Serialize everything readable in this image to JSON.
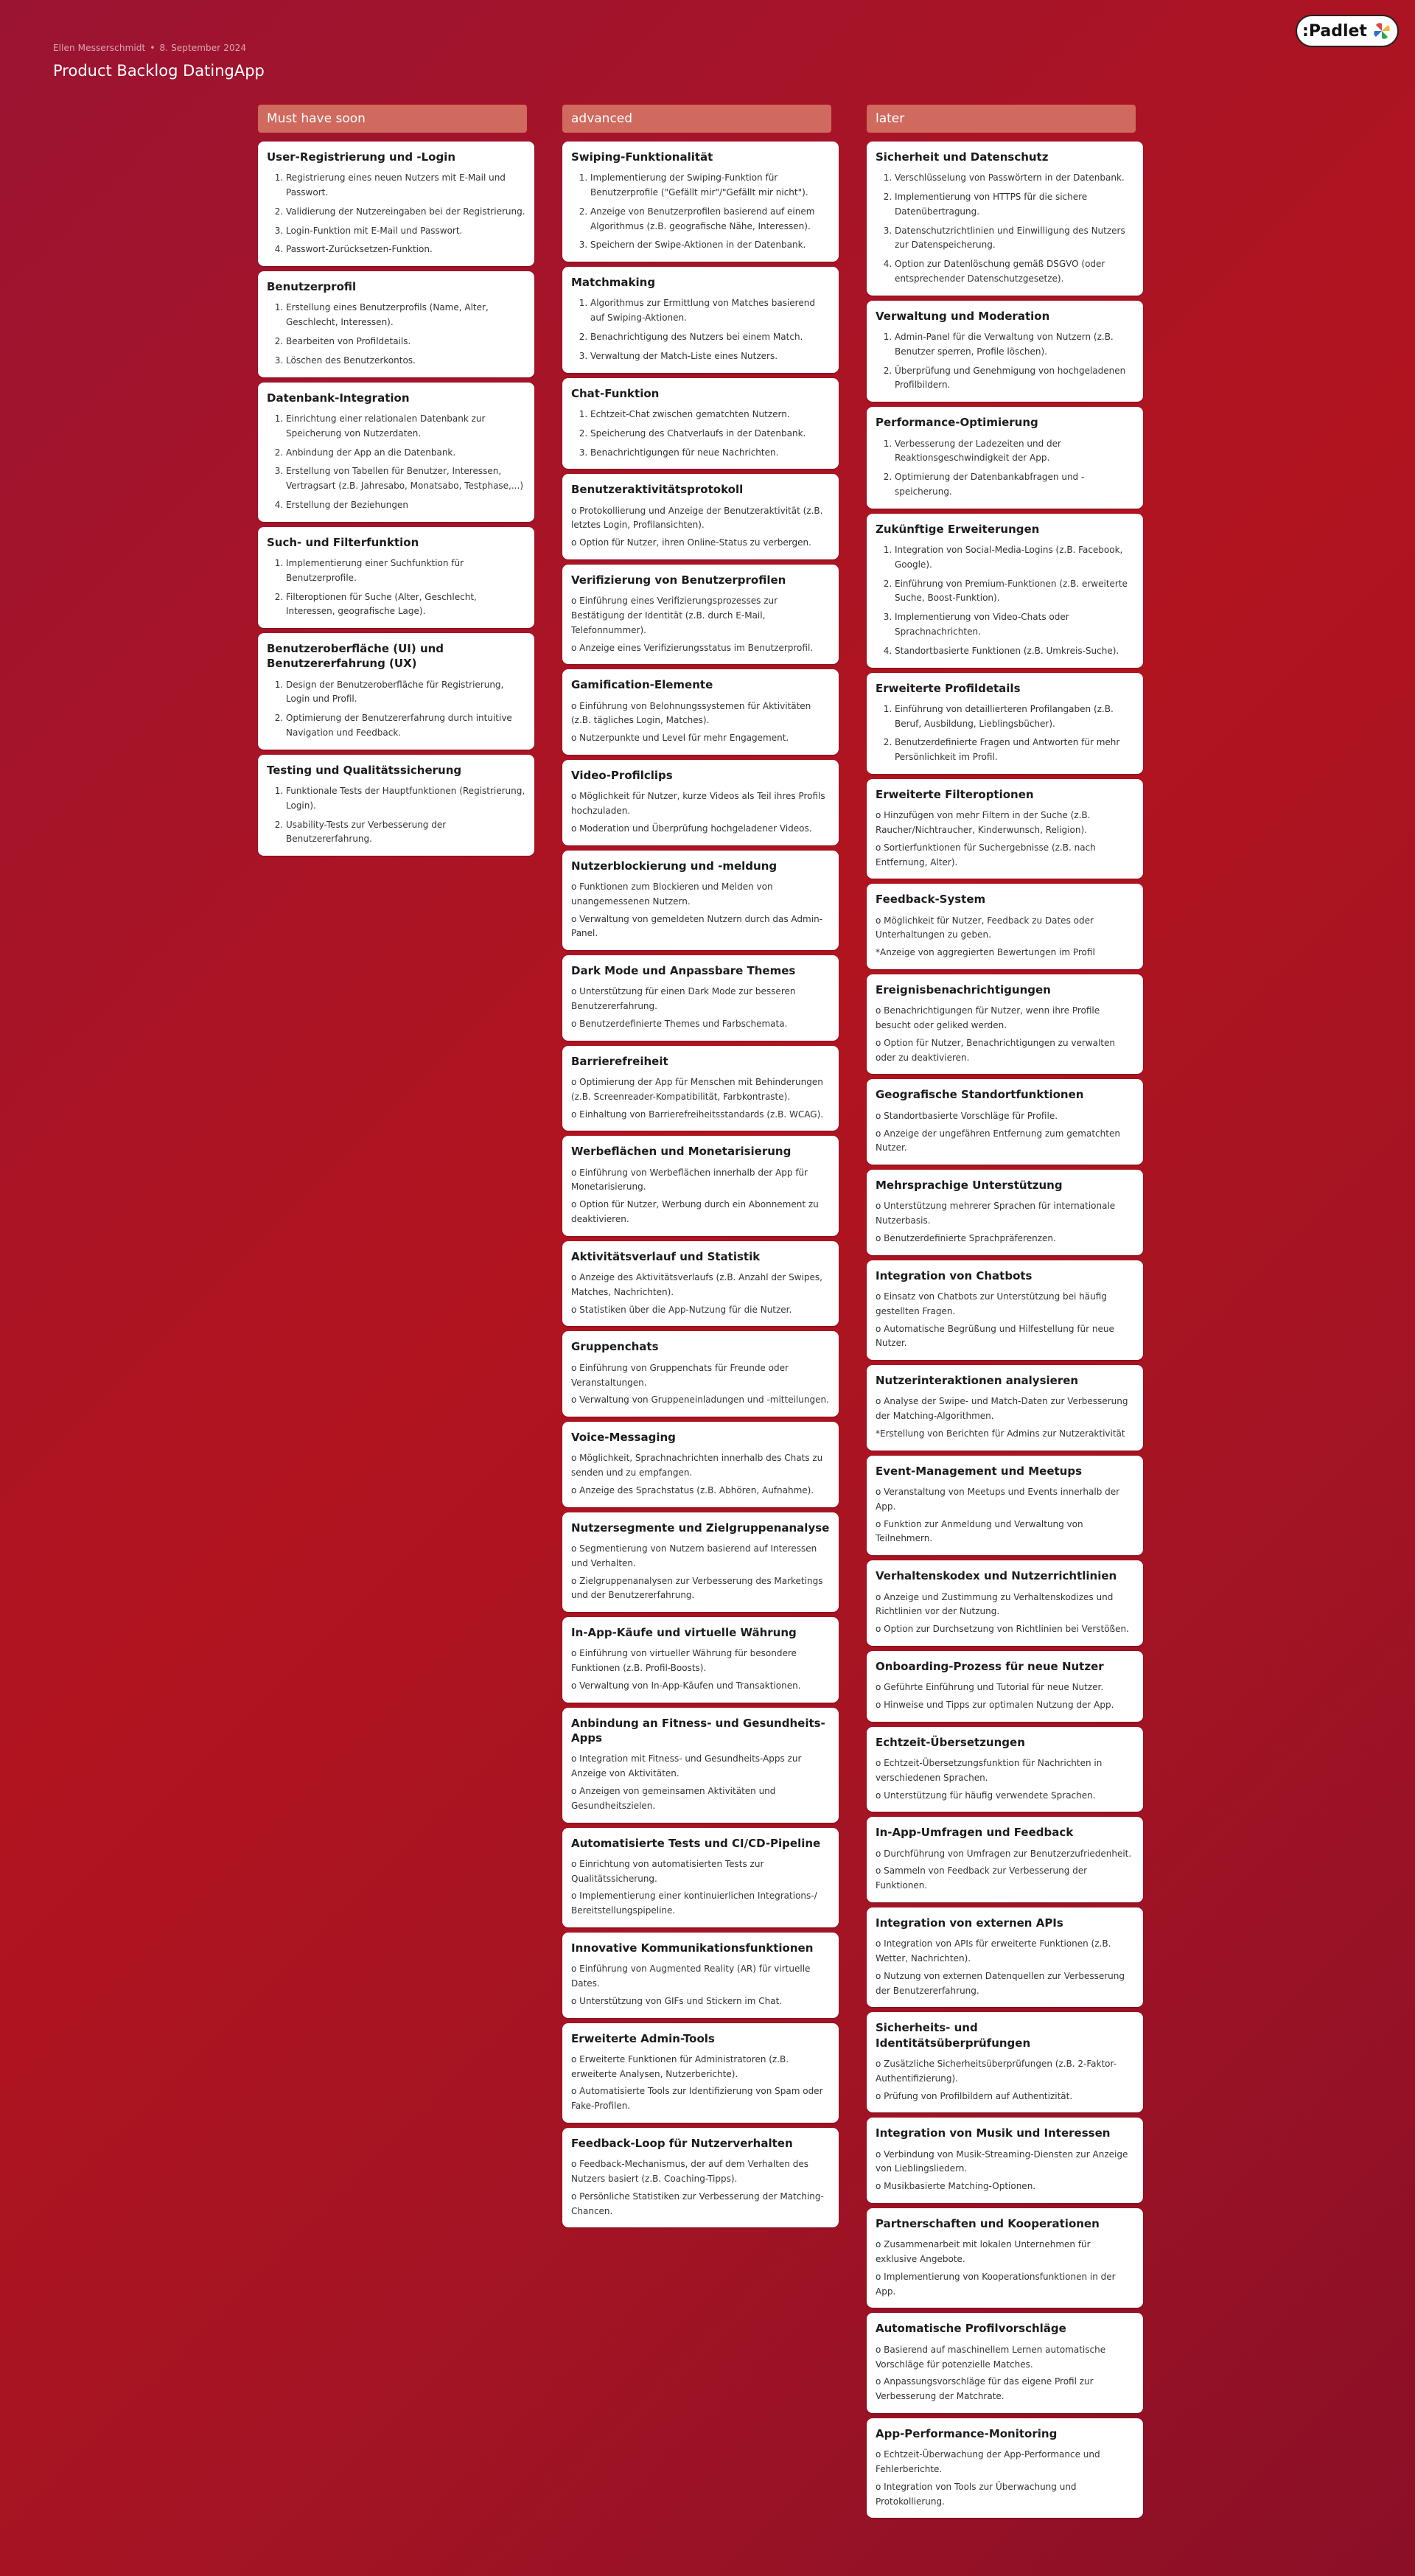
{
  "header": {
    "author": "Ellen Messerschmidt",
    "date": "8. September 2024",
    "title": "Product Backlog DatingApp"
  },
  "logo": {
    "text": ":Padlet",
    "icon": "padlet-flower-icon"
  },
  "columns": [
    {
      "title": "Must have soon",
      "cards": [
        {
          "title": "User-Registrierung und -Login",
          "style": "ol",
          "items": [
            "Registrierung eines neuen Nutzers mit E-Mail und Passwort.",
            "Validierung der Nutzereingaben bei der Registrierung.",
            "Login-Funktion mit E-Mail und Passwort.",
            "Passwort-Zurücksetzen-Funktion."
          ]
        },
        {
          "title": "Benutzerprofil",
          "style": "ol",
          "items": [
            "Erstellung eines Benutzerprofils (Name, Alter, Geschlecht, Interessen).",
            "Bearbeiten von Profildetails.",
            "Löschen des Benutzerkontos."
          ]
        },
        {
          "title": "Datenbank-Integration",
          "style": "ol",
          "items": [
            "Einrichtung einer relationalen Datenbank zur Speicherung von Nutzerdaten.",
            "Anbindung der App an die Datenbank.",
            "Erstellung von Tabellen für Benutzer, Interessen, Vertragsart (z.B. Jahresabo, Monatsabo, Testphase,...)",
            "Erstellung der Beziehungen"
          ]
        },
        {
          "title": "Such- und Filterfunktion",
          "style": "ol",
          "items": [
            "Implementierung einer Suchfunktion für Benutzerprofile.",
            "Filteroptionen für Suche (Alter, Geschlecht, Interessen, geografische Lage)."
          ]
        },
        {
          "title": "Benutzeroberfläche (UI) und Benutzererfahrung (UX)",
          "style": "ol",
          "items": [
            "Design der Benutzeroberfläche für Registrierung, Login und Profil.",
            "Optimierung der Benutzererfahrung durch intuitive Navigation und Feedback."
          ]
        },
        {
          "title": "Testing und Qualitätssicherung",
          "style": "ol",
          "items": [
            "Funktionale Tests der Hauptfunktionen (Registrierung, Login).",
            "Usability-Tests zur Verbesserung der Benutzererfahrung."
          ]
        }
      ]
    },
    {
      "title": "advanced",
      "cards": [
        {
          "title": "Swiping-Funktionalität",
          "style": "ol",
          "items": [
            "Implementierung der Swiping-Funktion für Benutzerprofile (\"Gefällt mir\"/\"Gefällt mir nicht\").",
            "Anzeige von Benutzerprofilen basierend auf einem Algorithmus (z.B. geografische Nähe, Interessen).",
            "Speichern der Swipe-Aktionen in der Datenbank."
          ]
        },
        {
          "title": "Matchmaking",
          "style": "ol",
          "items": [
            "Algorithmus zur Ermittlung von Matches basierend auf Swiping-Aktionen.",
            "Benachrichtigung des Nutzers bei einem Match.",
            "Verwaltung der Match-Liste eines Nutzers."
          ]
        },
        {
          "title": "Chat-Funktion",
          "style": "ol",
          "items": [
            "Echtzeit-Chat zwischen gematchten Nutzern.",
            "Speicherung des Chatverlaufs in der Datenbank.",
            "Benachrichtigungen für neue Nachrichten."
          ]
        },
        {
          "title": "Benutzeraktivitätsprotokoll",
          "style": "p",
          "items": [
            "o   Protokollierung und Anzeige der Benutzeraktivität (z.B. letztes Login, Profilansichten).",
            "o   Option für Nutzer, ihren Online-Status zu verbergen."
          ]
        },
        {
          "title": "Verifizierung von Benutzerprofilen",
          "style": "p",
          "items": [
            "o   Einführung eines Verifizierungsprozesses zur Bestätigung der Identität (z.B. durch E-Mail, Telefonnummer).",
            "o   Anzeige eines Verifizierungsstatus im Benutzerprofil."
          ]
        },
        {
          "title": "Gamification-Elemente",
          "style": "p",
          "items": [
            "o   Einführung von Belohnungssystemen für Aktivitäten (z.B. tägliches Login, Matches).",
            "o   Nutzerpunkte und Level für mehr Engagement."
          ]
        },
        {
          "title": "Video-Profilclips",
          "style": "p",
          "items": [
            "o   Möglichkeit für Nutzer, kurze Videos als Teil ihres Profils hochzuladen.",
            "o   Moderation und Überprüfung hochgeladener Videos."
          ]
        },
        {
          "title": "Nutzerblockierung und -meldung",
          "style": "p",
          "items": [
            "o   Funktionen zum Blockieren und Melden von unangemessenen Nutzern.",
            "o   Verwaltung von gemeldeten Nutzern durch das Admin-Panel."
          ]
        },
        {
          "title": "Dark Mode und Anpassbare Themes",
          "style": "p",
          "items": [
            "o   Unterstützung für einen Dark Mode zur besseren Benutzererfahrung.",
            "o   Benutzerdefinierte Themes und Farbschemata."
          ]
        },
        {
          "title": "Barrierefreiheit",
          "style": "p",
          "items": [
            "o   Optimierung der App für Menschen mit Behinderungen (z.B. Screenreader-Kompatibilität, Farbkontraste).",
            "o   Einhaltung von Barrierefreiheitsstandards (z.B. WCAG)."
          ]
        },
        {
          "title": "Werbeflächen und Monetarisierung",
          "style": "p",
          "items": [
            "o   Einführung von Werbeflächen innerhalb der App für Monetarisierung.",
            "o   Option für Nutzer, Werbung durch ein Abonnement zu deaktivieren."
          ]
        },
        {
          "title": "Aktivitätsverlauf und Statistik",
          "style": "p",
          "items": [
            "o   Anzeige des Aktivitätsverlaufs (z.B. Anzahl der Swipes, Matches, Nachrichten).",
            "o   Statistiken über die App-Nutzung für die Nutzer."
          ]
        },
        {
          "title": "Gruppenchats",
          "style": "p",
          "items": [
            "o   Einführung von Gruppenchats für Freunde oder Veranstaltungen.",
            "o   Verwaltung von Gruppeneinladungen und -mitteilungen."
          ]
        },
        {
          "title": "Voice-Messaging",
          "style": "p",
          "items": [
            "o   Möglichkeit, Sprachnachrichten innerhalb des Chats zu senden und zu empfangen.",
            "o   Anzeige des Sprachstatus (z.B. Abhören, Aufnahme)."
          ]
        },
        {
          "title": "Nutzersegmente und Zielgruppenanalyse",
          "style": "p",
          "items": [
            "o   Segmentierung von Nutzern basierend auf Interessen und Verhalten.",
            "o   Zielgruppenanalysen zur Verbesserung des Marketings und der Benutzererfahrung."
          ]
        },
        {
          "title": "In-App-Käufe und virtuelle Währung",
          "style": "p",
          "items": [
            "o   Einführung von virtueller Währung für besondere Funktionen (z.B. Profil-Boosts).",
            "o   Verwaltung von In-App-Käufen und Transaktionen."
          ]
        },
        {
          "title": "Anbindung an Fitness- und Gesundheits-Apps",
          "style": "p",
          "items": [
            "o   Integration mit Fitness- und Gesundheits-Apps zur Anzeige von Aktivitäten.",
            "o   Anzeigen von gemeinsamen Aktivitäten und Gesundheitszielen."
          ]
        },
        {
          "title": "Automatisierte Tests und CI/CD-Pipeline",
          "style": "p",
          "items": [
            "o   Einrichtung von automatisierten Tests zur Qualitätssicherung.",
            "o   Implementierung einer kontinuierlichen Integrations-/ Bereitstellungspipeline."
          ]
        },
        {
          "title": "Innovative Kommunikationsfunktionen",
          "style": "p",
          "items": [
            "o   Einführung von Augmented Reality (AR) für virtuelle Dates.",
            "o   Unterstützung von GIFs und Stickern im Chat."
          ]
        },
        {
          "title": "Erweiterte Admin-Tools",
          "style": "p",
          "items": [
            "o   Erweiterte Funktionen für Administratoren (z.B. erweiterte Analysen, Nutzerberichte).",
            "o   Automatisierte Tools zur Identifizierung von Spam oder Fake-Profilen."
          ]
        },
        {
          "title": "Feedback-Loop für Nutzerverhalten",
          "style": "p",
          "items": [
            "o   Feedback-Mechanismus, der auf dem Verhalten des Nutzers basiert (z.B. Coaching-Tipps).",
            "o   Persönliche Statistiken zur Verbesserung der Matching-Chancen."
          ]
        }
      ]
    },
    {
      "title": "later",
      "cards": [
        {
          "title": "Sicherheit und Datenschutz",
          "style": "ol",
          "items": [
            "Verschlüsselung von Passwörtern in der Datenbank.",
            "Implementierung von HTTPS für die sichere Datenübertragung.",
            "Datenschutzrichtlinien und Einwilligung des Nutzers zur Datenspeicherung.",
            "Option zur Datenlöschung gemäß DSGVO (oder entsprechender Datenschutzgesetze)."
          ]
        },
        {
          "title": "Verwaltung und Moderation",
          "style": "ol",
          "items": [
            "Admin-Panel für die Verwaltung von Nutzern (z.B. Benutzer sperren, Profile löschen).",
            "Überprüfung und Genehmigung von hochgeladenen Profilbildern."
          ]
        },
        {
          "title": "Performance-Optimierung",
          "style": "ol",
          "items": [
            "Verbesserung der Ladezeiten und der Reaktionsgeschwindigkeit der App.",
            "Optimierung der Datenbankabfragen und -speicherung."
          ]
        },
        {
          "title": "Zukünftige Erweiterungen",
          "style": "ol",
          "items": [
            "Integration von Social-Media-Logins (z.B. Facebook, Google).",
            "Einführung von Premium-Funktionen (z.B. erweiterte Suche, Boost-Funktion).",
            "Implementierung von Video-Chats oder Sprachnachrichten.",
            "Standortbasierte Funktionen (z.B. Umkreis-Suche)."
          ]
        },
        {
          "title": "Erweiterte Profildetails",
          "style": "ol",
          "items": [
            "Einführung von detaillierteren Profilangaben (z.B. Beruf, Ausbildung, Lieblingsbücher).",
            "Benutzerdefinierte Fragen und Antworten für mehr Persönlichkeit im Profil."
          ]
        },
        {
          "title": "Erweiterte Filteroptionen",
          "style": "p",
          "items": [
            "o   Hinzufügen von mehr Filtern in der Suche (z.B. Raucher/Nichtraucher, Kinderwunsch, Religion).",
            "o   Sortierfunktionen für Suchergebnisse (z.B. nach Entfernung, Alter)."
          ]
        },
        {
          "title": "Feedback-System",
          "style": "p",
          "items": [
            "o   Möglichkeit für Nutzer, Feedback zu Dates oder Unterhaltungen zu geben.",
            "*Anzeige von aggregierten Bewertungen im Profil"
          ]
        },
        {
          "title": "Ereignisbenachrichtigungen",
          "style": "p",
          "items": [
            "o   Benachrichtigungen für Nutzer, wenn ihre Profile besucht oder geliked werden.",
            "o   Option für Nutzer, Benachrichtigungen zu verwalten oder zu deaktivieren."
          ]
        },
        {
          "title": "Geografische Standortfunktionen",
          "style": "p",
          "items": [
            "o   Standortbasierte Vorschläge für Profile.",
            "o   Anzeige der ungefähren Entfernung zum gematchten Nutzer."
          ]
        },
        {
          "title": "Mehrsprachige Unterstützung",
          "style": "p",
          "items": [
            "o   Unterstützung mehrerer Sprachen für internationale Nutzerbasis.",
            "o   Benutzerdefinierte Sprachpräferenzen."
          ]
        },
        {
          "title": "Integration von Chatbots",
          "style": "p",
          "items": [
            "o   Einsatz von Chatbots zur Unterstützung bei häufig gestellten Fragen.",
            "o   Automatische Begrüßung und Hilfestellung für neue Nutzer."
          ]
        },
        {
          "title": "Nutzerinteraktionen analysieren",
          "style": "p",
          "items": [
            "o   Analyse der Swipe- und Match-Daten zur Verbesserung der Matching-Algorithmen.",
            "*Erstellung von Berichten für Admins zur Nutzeraktivität"
          ]
        },
        {
          "title": "Event-Management und Meetups",
          "style": "p",
          "items": [
            "o   Veranstaltung von Meetups und Events innerhalb der App.",
            "o   Funktion zur Anmeldung und Verwaltung von Teilnehmern."
          ]
        },
        {
          "title": "Verhaltenskodex und Nutzerrichtlinien",
          "style": "p",
          "items": [
            "o   Anzeige und Zustimmung zu Verhaltenskodizes und Richtlinien vor der Nutzung.",
            "o   Option zur Durchsetzung von Richtlinien bei Verstößen."
          ]
        },
        {
          "title": "Onboarding-Prozess für neue Nutzer",
          "style": "p",
          "items": [
            "o   Geführte Einführung und Tutorial für neue Nutzer.",
            "o   Hinweise und Tipps zur optimalen Nutzung der App."
          ]
        },
        {
          "title": "Echtzeit-Übersetzungen",
          "style": "p",
          "items": [
            "o   Echtzeit-Übersetzungsfunktion für Nachrichten in verschiedenen Sprachen.",
            "o   Unterstützung für häufig verwendete Sprachen."
          ]
        },
        {
          "title": "In-App-Umfragen und Feedback",
          "style": "p",
          "items": [
            "o   Durchführung von Umfragen zur Benutzerzufriedenheit.",
            "o   Sammeln von Feedback zur Verbesserung der Funktionen."
          ]
        },
        {
          "title": "Integration von externen APIs",
          "style": "p",
          "items": [
            "o   Integration von APIs für erweiterte Funktionen (z.B. Wetter, Nachrichten).",
            "o   Nutzung von externen Datenquellen zur Verbesserung der Benutzererfahrung."
          ]
        },
        {
          "title": "Sicherheits- und Identitätsüberprüfungen",
          "style": "p",
          "items": [
            "o   Zusätzliche Sicherheitsüberprüfungen (z.B. 2-Faktor-Authentifizierung).",
            "o   Prüfung von Profilbildern auf Authentizität."
          ]
        },
        {
          "title": "Integration von Musik und Interessen",
          "style": "p",
          "items": [
            "o   Verbindung von Musik-Streaming-Diensten zur Anzeige von Lieblingsliedern.",
            "o   Musikbasierte Matching-Optionen."
          ]
        },
        {
          "title": "Partnerschaften und Kooperationen",
          "style": "p",
          "items": [
            "o   Zusammenarbeit mit lokalen Unternehmen für exklusive Angebote.",
            "o   Implementierung von Kooperationsfunktionen in der App."
          ]
        },
        {
          "title": "Automatische Profilvorschläge",
          "style": "p",
          "items": [
            "o   Basierend auf maschinellem Lernen automatische Vorschläge für potenzielle Matches.",
            "o   Anpassungsvorschläge für das eigene Profil zur Verbesserung der Matchrate."
          ]
        },
        {
          "title": "App-Performance-Monitoring",
          "style": "p",
          "items": [
            "o   Echtzeit-Überwachung der App-Performance und Fehlerberichte.",
            "o   Integration von Tools zur Überwachung und Protokollierung."
          ]
        }
      ]
    }
  ]
}
